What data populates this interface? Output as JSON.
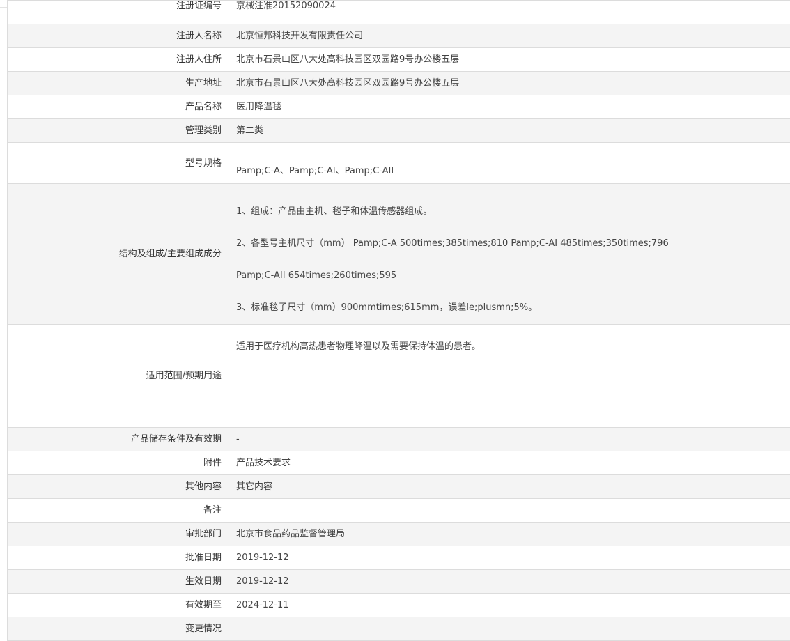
{
  "rows": [
    {
      "label": "注册证编号",
      "value": "京械注准20152090024"
    },
    {
      "label": "注册人名称",
      "value": "北京恒邦科技开发有限责任公司"
    },
    {
      "label": "注册人住所",
      "value": "北京市石景山区八大处高科技园区双园路9号办公楼五层"
    },
    {
      "label": "生产地址",
      "value": "北京市石景山区八大处高科技园区双园路9号办公楼五层"
    },
    {
      "label": "产品名称",
      "value": "医用降温毯"
    },
    {
      "label": "管理类别",
      "value": "第二类"
    },
    {
      "label": "型号规格",
      "value": "Pamp;C-A、Pamp;C-AI、Pamp;C-AII"
    },
    {
      "label": "结构及组成/主要组成成分",
      "lines": [
        "1、组成：产品由主机、毯子和体温传感器组成。",
        "2、各型号主机尺寸（mm） Pamp;C-A 500times;385times;810 Pamp;C-AI 485times;350times;796",
        "Pamp;C-AII 654times;260times;595",
        "3、标准毯子尺寸（mm）900mmtimes;615mm，误差le;plusmn;5%。"
      ]
    },
    {
      "label": "适用范围/预期用途",
      "value": "适用于医疗机构高热患者物理降温以及需要保持体温的患者。"
    },
    {
      "label": "产品储存条件及有效期",
      "value": "-"
    },
    {
      "label": "附件",
      "value": "产品技术要求"
    },
    {
      "label": "其他内容",
      "value": "其它内容"
    },
    {
      "label": "备注",
      "value": ""
    },
    {
      "label": "审批部门",
      "value": "北京市食品药品监督管理局"
    },
    {
      "label": "批准日期",
      "value": "2019-12-12"
    },
    {
      "label": "生效日期",
      "value": "2019-12-12"
    },
    {
      "label": "有效期至",
      "value": "2024-12-11"
    },
    {
      "label": "变更情况",
      "value": ""
    }
  ]
}
